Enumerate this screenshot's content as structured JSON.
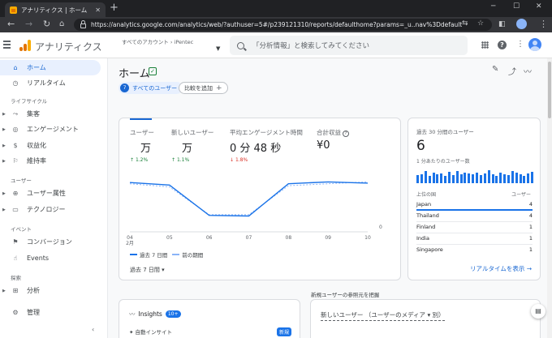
{
  "browser": {
    "tab_title": "アナリティクス | ホーム",
    "new_tab": "+",
    "url": "https://analytics.google.com/analytics/web/?authuser=5#/p239121310/reports/defaulthome?params=_u..nav%3Ddefault",
    "controls": {
      "minimize": "─",
      "maximize": "☐",
      "close": "✕"
    }
  },
  "header": {
    "app_name": "アナリティクス",
    "breadcrumb": "すべてのアカウント ›  iPentec",
    "account": "",
    "search_placeholder": "「分析情報」と検索してみてください",
    "logo_colors": [
      "#f9ab00",
      "#e37400",
      "#e37400"
    ]
  },
  "sidebar": {
    "items": [
      {
        "label": "ホーム",
        "icon": "home-icon"
      },
      {
        "label": "リアルタイム",
        "icon": "clock-icon"
      },
      {
        "label": "集客",
        "icon": "acquisition-icon"
      },
      {
        "label": "エンゲージメント",
        "icon": "engagement-icon"
      },
      {
        "label": "収益化",
        "icon": "monetization-icon"
      },
      {
        "label": "維持率",
        "icon": "retention-icon"
      },
      {
        "label": "ユーザー属性",
        "icon": "globe-icon"
      },
      {
        "label": "テクノロジー",
        "icon": "tech-icon"
      },
      {
        "label": "コンバージョン",
        "icon": "flag-icon"
      },
      {
        "label": "Events",
        "icon": "touch-icon"
      },
      {
        "label": "分析",
        "icon": "explore-icon"
      },
      {
        "label": "管理",
        "icon": "gear-icon"
      }
    ],
    "sections": {
      "lifecycle": "ライフサイクル",
      "user": "ユーザー",
      "event": "イベント",
      "explore": "探索"
    },
    "collapse_icon": "‹"
  },
  "home": {
    "title": "ホーム",
    "chip_users_letter": "7",
    "chip_users": "すべてのユーザー",
    "chip_compare": "比較を追加",
    "chip_compare_plus": "+"
  },
  "metrics": [
    {
      "label": "ユーザー",
      "value": "万",
      "delta": "1.2%",
      "direction": "up"
    },
    {
      "label": "新しいユーザー",
      "value": "万",
      "delta": "1.1%",
      "direction": "up"
    },
    {
      "label": "平均エンゲージメント時間",
      "value": "0 分 48 秒",
      "delta": "1.8%",
      "direction": "down"
    },
    {
      "label": "合計収益",
      "value": "¥0",
      "delta": "",
      "direction": ""
    }
  ],
  "chart_data": {
    "type": "line",
    "x": [
      "04",
      "05",
      "06",
      "07",
      "08",
      "09",
      "10"
    ],
    "x_sublabel": "2月",
    "y_tick": "0",
    "ylim": [
      0,
      1
    ],
    "series": [
      {
        "name": "過去 7 日間",
        "values": [
          0.78,
          0.74,
          0.26,
          0.25,
          0.76,
          0.79,
          0.77
        ],
        "color": "#1a73e8",
        "dash": false
      },
      {
        "name": "前の期間",
        "values": [
          0.76,
          0.71,
          0.27,
          0.27,
          0.73,
          0.76,
          0.79
        ],
        "color": "#8ab4f8",
        "dash": true
      }
    ]
  },
  "metrics_footer": {
    "period": "過去 7 日間 ▾"
  },
  "realtime": {
    "title": "過去 30 分間のユーザー",
    "value": "6",
    "subtitle": "1 分あたりのユーザー数",
    "bars": [
      0.55,
      0.6,
      0.85,
      0.5,
      0.7,
      0.6,
      0.65,
      0.5,
      0.8,
      0.55,
      0.85,
      0.6,
      0.75,
      0.65,
      0.6,
      0.7,
      0.55,
      0.65,
      0.9,
      0.6,
      0.5,
      0.75,
      0.6,
      0.55,
      0.85,
      0.7,
      0.6,
      0.5,
      0.65,
      0.8
    ],
    "col_country": "上位の国",
    "col_users": "ユーザー",
    "rows": [
      {
        "country": "Japan",
        "users": "4"
      },
      {
        "country": "Thailand",
        "users": "4"
      },
      {
        "country": "Finland",
        "users": "1"
      },
      {
        "country": "India",
        "users": "1"
      },
      {
        "country": "Singapore",
        "users": "1"
      }
    ],
    "link": "リアルタイムを表示 →"
  },
  "bottom": {
    "section_label": "新規ユーザーの参照元を把握",
    "insights_title": "Insights",
    "insights_badge": "10+",
    "insights_sub": "自動インサイト",
    "insights_new": "新規",
    "new_users_dropdown": "新しいユーザー （ユーザーのメディア ▾ 別）"
  }
}
